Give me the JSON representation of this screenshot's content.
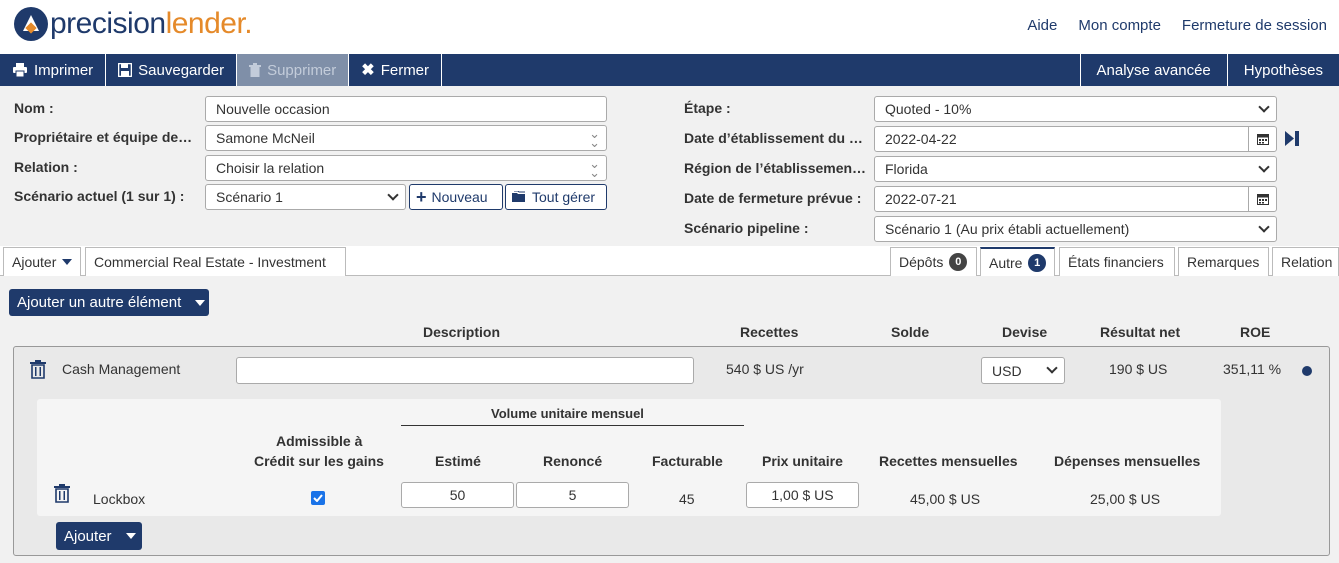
{
  "app": {
    "logo_part1": "precision",
    "logo_part2": "lender.",
    "top_links": [
      "Aide",
      "Mon compte",
      "Fermeture de session"
    ]
  },
  "toolbar": {
    "print": "Imprimer",
    "save": "Sauvegarder",
    "delete": "Supprimer",
    "close": "Fermer",
    "advanced": "Analyse avancée",
    "assumptions": "Hypothèses"
  },
  "form": {
    "name_label": "Nom :",
    "name_value": "Nouvelle occasion",
    "owner_label": "Propriétaire et équipe de…",
    "owner_value": "Samone McNeil",
    "relation_label": "Relation :",
    "relation_value": "Choisir la relation",
    "scenario_label": "Scénario actuel (1 sur 1) :",
    "scenario_value": "Scénario 1",
    "new_button": "Nouveau",
    "manage_button": "Tout gérer",
    "stage_label": "Étape :",
    "stage_value": "Quoted - 10%",
    "origination_date_label": "Date d’établissement du …",
    "origination_date_value": "2022-04-22",
    "region_label": "Région de l’établissemen…",
    "region_value": "Florida",
    "close_date_label": "Date de fermeture prévue :",
    "close_date_value": "2022-07-21",
    "pipeline_label": "Scénario pipeline :",
    "pipeline_value": "Scénario 1 (Au prix établi actuellement)"
  },
  "tabs_left": {
    "add": "Ajouter",
    "product": "Commercial Real Estate - Investment"
  },
  "tabs_right": [
    {
      "label": "Dépôts",
      "badge": "0"
    },
    {
      "label": "Autre",
      "badge": "1"
    },
    {
      "label": "États financiers"
    },
    {
      "label": "Remarques"
    },
    {
      "label": "Relation"
    }
  ],
  "colors": {
    "brand": "#1f3a6b",
    "accent": "#e58a2a",
    "badge_grey": "#444444"
  },
  "main": {
    "add_other": "Ajouter un autre élément",
    "columns": [
      "Description",
      "Recettes",
      "Solde",
      "Devise",
      "Résultat net",
      "ROE"
    ],
    "item": {
      "name": "Cash Management",
      "description": "",
      "revenue": "540 $ US /yr",
      "currency": "USD",
      "net_income": "190 $ US",
      "roe": "351,11 %"
    },
    "sub": {
      "group_header": "Volume unitaire mensuel",
      "eligible_header_1": "Admissible à",
      "eligible_header_2": "Crédit sur les gains",
      "estimated_header": "Estimé",
      "waived_header": "Renoncé",
      "billable_header": "Facturable",
      "unit_price_header": "Prix unitaire",
      "monthly_revenue_header": "Recettes mensuelles",
      "monthly_expenses_header": "Dépenses mensuelles",
      "row": {
        "name": "Lockbox",
        "eligible": true,
        "estimated": "50",
        "waived": "5",
        "billable": "45",
        "unit_price": "1,00 $ US",
        "monthly_revenue": "45,00 $ US",
        "monthly_expenses": "25,00 $ US"
      }
    },
    "add_button": "Ajouter"
  }
}
